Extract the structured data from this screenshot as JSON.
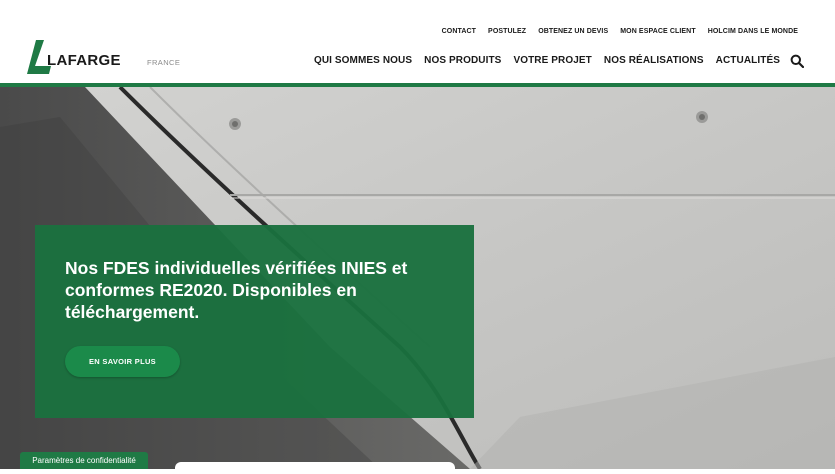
{
  "brand": {
    "name": "LAFARGE",
    "country": "FRANCE",
    "color": "#1f7a45"
  },
  "top_nav": [
    "CONTACT",
    "POSTULEZ",
    "OBTENEZ UN DEVIS",
    "MON ESPACE CLIENT",
    "HOLCIM DANS LE MONDE"
  ],
  "main_nav": [
    "QUI SOMMES NOUS",
    "NOS PRODUITS",
    "VOTRE PROJET",
    "NOS RÉALISATIONS",
    "ACTUALITÉS"
  ],
  "search": {
    "icon": "search-icon"
  },
  "hero": {
    "title": "Nos FDES individuelles vérifiées INIES et conformes RE2020. Disponibles en téléchargement.",
    "cta_label": "EN SAVOIR PLUS"
  },
  "privacy": {
    "label": "Paramètres de confidentialité"
  }
}
